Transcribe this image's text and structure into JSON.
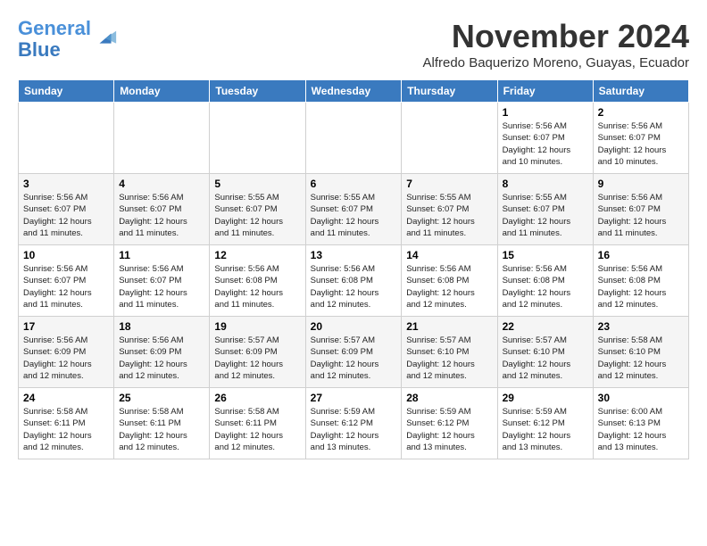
{
  "header": {
    "logo_line1": "General",
    "logo_line2": "Blue",
    "month_year": "November 2024",
    "location": "Alfredo Baquerizo Moreno, Guayas, Ecuador"
  },
  "weekdays": [
    "Sunday",
    "Monday",
    "Tuesday",
    "Wednesday",
    "Thursday",
    "Friday",
    "Saturday"
  ],
  "weeks": [
    [
      {
        "day": "",
        "info": ""
      },
      {
        "day": "",
        "info": ""
      },
      {
        "day": "",
        "info": ""
      },
      {
        "day": "",
        "info": ""
      },
      {
        "day": "",
        "info": ""
      },
      {
        "day": "1",
        "info": "Sunrise: 5:56 AM\nSunset: 6:07 PM\nDaylight: 12 hours\nand 10 minutes."
      },
      {
        "day": "2",
        "info": "Sunrise: 5:56 AM\nSunset: 6:07 PM\nDaylight: 12 hours\nand 10 minutes."
      }
    ],
    [
      {
        "day": "3",
        "info": "Sunrise: 5:56 AM\nSunset: 6:07 PM\nDaylight: 12 hours\nand 11 minutes."
      },
      {
        "day": "4",
        "info": "Sunrise: 5:56 AM\nSunset: 6:07 PM\nDaylight: 12 hours\nand 11 minutes."
      },
      {
        "day": "5",
        "info": "Sunrise: 5:55 AM\nSunset: 6:07 PM\nDaylight: 12 hours\nand 11 minutes."
      },
      {
        "day": "6",
        "info": "Sunrise: 5:55 AM\nSunset: 6:07 PM\nDaylight: 12 hours\nand 11 minutes."
      },
      {
        "day": "7",
        "info": "Sunrise: 5:55 AM\nSunset: 6:07 PM\nDaylight: 12 hours\nand 11 minutes."
      },
      {
        "day": "8",
        "info": "Sunrise: 5:55 AM\nSunset: 6:07 PM\nDaylight: 12 hours\nand 11 minutes."
      },
      {
        "day": "9",
        "info": "Sunrise: 5:56 AM\nSunset: 6:07 PM\nDaylight: 12 hours\nand 11 minutes."
      }
    ],
    [
      {
        "day": "10",
        "info": "Sunrise: 5:56 AM\nSunset: 6:07 PM\nDaylight: 12 hours\nand 11 minutes."
      },
      {
        "day": "11",
        "info": "Sunrise: 5:56 AM\nSunset: 6:07 PM\nDaylight: 12 hours\nand 11 minutes."
      },
      {
        "day": "12",
        "info": "Sunrise: 5:56 AM\nSunset: 6:08 PM\nDaylight: 12 hours\nand 11 minutes."
      },
      {
        "day": "13",
        "info": "Sunrise: 5:56 AM\nSunset: 6:08 PM\nDaylight: 12 hours\nand 12 minutes."
      },
      {
        "day": "14",
        "info": "Sunrise: 5:56 AM\nSunset: 6:08 PM\nDaylight: 12 hours\nand 12 minutes."
      },
      {
        "day": "15",
        "info": "Sunrise: 5:56 AM\nSunset: 6:08 PM\nDaylight: 12 hours\nand 12 minutes."
      },
      {
        "day": "16",
        "info": "Sunrise: 5:56 AM\nSunset: 6:08 PM\nDaylight: 12 hours\nand 12 minutes."
      }
    ],
    [
      {
        "day": "17",
        "info": "Sunrise: 5:56 AM\nSunset: 6:09 PM\nDaylight: 12 hours\nand 12 minutes."
      },
      {
        "day": "18",
        "info": "Sunrise: 5:56 AM\nSunset: 6:09 PM\nDaylight: 12 hours\nand 12 minutes."
      },
      {
        "day": "19",
        "info": "Sunrise: 5:57 AM\nSunset: 6:09 PM\nDaylight: 12 hours\nand 12 minutes."
      },
      {
        "day": "20",
        "info": "Sunrise: 5:57 AM\nSunset: 6:09 PM\nDaylight: 12 hours\nand 12 minutes."
      },
      {
        "day": "21",
        "info": "Sunrise: 5:57 AM\nSunset: 6:10 PM\nDaylight: 12 hours\nand 12 minutes."
      },
      {
        "day": "22",
        "info": "Sunrise: 5:57 AM\nSunset: 6:10 PM\nDaylight: 12 hours\nand 12 minutes."
      },
      {
        "day": "23",
        "info": "Sunrise: 5:58 AM\nSunset: 6:10 PM\nDaylight: 12 hours\nand 12 minutes."
      }
    ],
    [
      {
        "day": "24",
        "info": "Sunrise: 5:58 AM\nSunset: 6:11 PM\nDaylight: 12 hours\nand 12 minutes."
      },
      {
        "day": "25",
        "info": "Sunrise: 5:58 AM\nSunset: 6:11 PM\nDaylight: 12 hours\nand 12 minutes."
      },
      {
        "day": "26",
        "info": "Sunrise: 5:58 AM\nSunset: 6:11 PM\nDaylight: 12 hours\nand 12 minutes."
      },
      {
        "day": "27",
        "info": "Sunrise: 5:59 AM\nSunset: 6:12 PM\nDaylight: 12 hours\nand 13 minutes."
      },
      {
        "day": "28",
        "info": "Sunrise: 5:59 AM\nSunset: 6:12 PM\nDaylight: 12 hours\nand 13 minutes."
      },
      {
        "day": "29",
        "info": "Sunrise: 5:59 AM\nSunset: 6:12 PM\nDaylight: 12 hours\nand 13 minutes."
      },
      {
        "day": "30",
        "info": "Sunrise: 6:00 AM\nSunset: 6:13 PM\nDaylight: 12 hours\nand 13 minutes."
      }
    ]
  ]
}
